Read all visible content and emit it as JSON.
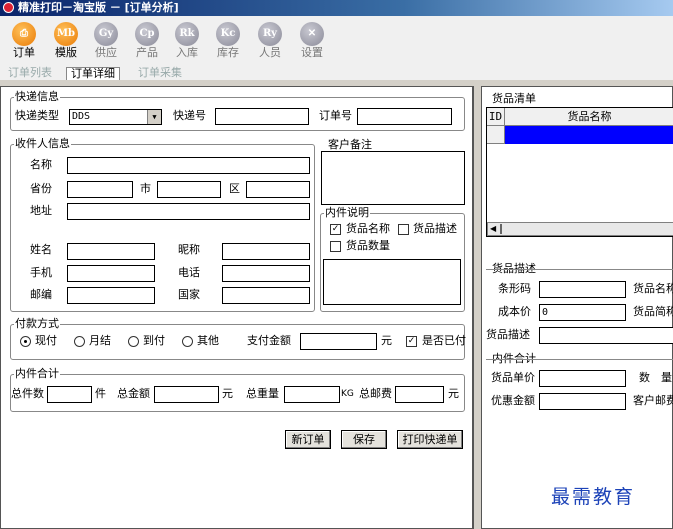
{
  "window": {
    "title": "精准打印－淘宝版 － [订单分析]"
  },
  "toolbar": [
    {
      "abbr": "",
      "label": "订单",
      "icon": "printer-icon",
      "enabled": true
    },
    {
      "abbr": "Mb",
      "label": "模版",
      "icon": "template-icon",
      "enabled": true
    },
    {
      "abbr": "Gy",
      "label": "供应",
      "icon": "supply-icon",
      "enabled": false
    },
    {
      "abbr": "Cp",
      "label": "产品",
      "icon": "product-icon",
      "enabled": false
    },
    {
      "abbr": "Rk",
      "label": "入库",
      "icon": "stock-in-icon",
      "enabled": false
    },
    {
      "abbr": "Kc",
      "label": "库存",
      "icon": "inventory-icon",
      "enabled": false
    },
    {
      "abbr": "Ry",
      "label": "人员",
      "icon": "staff-icon",
      "enabled": false
    },
    {
      "abbr": "",
      "label": "设置",
      "icon": "settings-icon",
      "enabled": false
    }
  ],
  "tabs": [
    {
      "label": "订单列表",
      "active": false
    },
    {
      "label": "订单详细",
      "active": true
    },
    {
      "label": "订单采集",
      "active": false
    }
  ],
  "express": {
    "caption": "快递信息",
    "type_label": "快递类型",
    "type_value": "DDS",
    "no_label": "快递号",
    "no_value": "",
    "order_label": "订单号",
    "order_value": ""
  },
  "receiver": {
    "caption": "收件人信息",
    "name": "名称",
    "province": "省份",
    "city": "市",
    "district": "区",
    "address": "地址",
    "person": "姓名",
    "nickname": "昵称",
    "mobile": "手机",
    "phone": "电话",
    "zip": "邮编",
    "country": "国家"
  },
  "customer_note": {
    "caption": "客户备注"
  },
  "contents": {
    "caption": "内件说明",
    "opt_name": "货品名称",
    "opt_name_checked": true,
    "opt_desc": "货品描述",
    "opt_desc_checked": false,
    "opt_qty": "货品数量",
    "opt_qty_checked": false
  },
  "payment": {
    "caption": "付款方式",
    "options": [
      "现付",
      "月结",
      "到付",
      "其他"
    ],
    "selected": "现付",
    "amount_label": "支付金额",
    "amount_unit": "元",
    "paid_label": "是否已付",
    "paid_checked": true
  },
  "totals": {
    "caption": "内件合计",
    "count_label": "总件数",
    "count_unit": "件",
    "amount_label": "总金额",
    "amount_unit": "元",
    "weight_label": "总重量",
    "weight_unit": "KG",
    "postage_label": "总邮费",
    "postage_unit": "元"
  },
  "actions": {
    "new": "新订单",
    "save": "保存",
    "print": "打印快递单"
  },
  "goods_list": {
    "caption": "货品清单",
    "col_id": "ID",
    "col_name": "货品名称"
  },
  "goods_desc": {
    "caption": "货品描述",
    "barcode": "条形码",
    "name": "货品名称",
    "cost": "成本价",
    "cost_value": "0",
    "short": "货品简称",
    "desc": "货品描述"
  },
  "goods_totals": {
    "caption": "内件合计",
    "unit_price": "货品单价",
    "qty": "数　量",
    "discount": "优惠金额",
    "postage": "客户邮费"
  },
  "watermark": "最需教育",
  "colors": {
    "titlebar": "#0a246a",
    "selected_row": "#0000ff",
    "icon_active": "#f39a1c",
    "icon_inactive": "#9c9caa"
  }
}
